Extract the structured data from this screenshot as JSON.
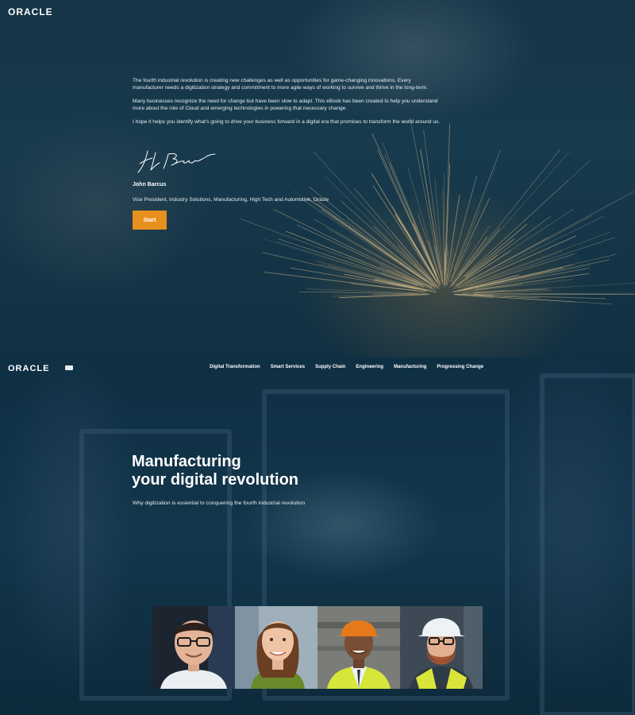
{
  "intro": {
    "logo": "ORACLE",
    "paragraphs": [
      "The fourth industrial revolution is creating new challenges as well as opportunities for game-changing innovations. Every manufacturer needs a digitization strategy and commitment to more agile ways of working to survive and thrive in the long-term.",
      "Many businesses recognize the need for change but have been slow to adapt. This eBook has been created to help you understand more about the role of Cloud and emerging technologies in powering that necessary change.",
      "I hope it helps you identify what's going to drive your business forward in a digital era that promises to transform the world around us."
    ],
    "signature_name": "John Barcus",
    "signature_title": "Vice President, Industry Solutions, Manufacturing, High Tech and Automotive, Oracle",
    "start_label": "Start"
  },
  "header": {
    "logo": "ORACLE",
    "nav": [
      "Digital Transformation",
      "Smart Services",
      "Supply Chain",
      "Engineering",
      "Manufacturing",
      "Progressing Change"
    ]
  },
  "hero": {
    "title_line1": "Manufacturing",
    "title_line2": "your digital revolution",
    "subtitle": "Why digitization is essential to conquering the fourth industrial revolution"
  },
  "people": [
    {
      "icon": "man-glasses-portrait"
    },
    {
      "icon": "woman-portrait"
    },
    {
      "icon": "worker-hardhat-orange-portrait"
    },
    {
      "icon": "worker-hardhat-white-portrait"
    }
  ],
  "colors": {
    "accent": "#e8901d",
    "background": "#0f2f43"
  }
}
